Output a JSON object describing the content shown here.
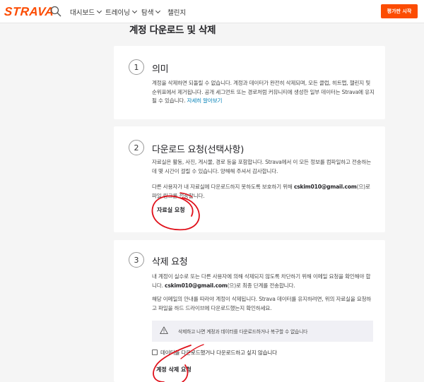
{
  "nav": {
    "logo": "STRAVA",
    "search_icon": "search-icon",
    "items": [
      {
        "label": "대시보드",
        "dropdown": true
      },
      {
        "label": "트레이닝",
        "dropdown": true
      },
      {
        "label": "탐색",
        "dropdown": true
      },
      {
        "label": "챌린지",
        "dropdown": false
      }
    ],
    "cta_label": "평가판 시작"
  },
  "page": {
    "title": "계정 다운로드 및 삭제"
  },
  "sections": {
    "meaning": {
      "number": "1",
      "title": "의미",
      "text": "계정을 삭제하면 되돌릴 수 없습니다. 계정과 데이터가 완전히 삭제되며, 모든 클럽, 히트맵, 챌린지 및 순위표에서 제거됩니다. 공개 세그먼트 또는 경로처럼 커뮤니티에 생성한 일부 데이터는 Strava에 유지될 수 있습니다.",
      "link": "자세히 알아보기"
    },
    "download": {
      "number": "2",
      "title": "다운로드 요청(선택사항)",
      "text1": "자료실은 활동, 사진, 게시물, 경로 등을 포함합니다. Strava에서 이 모든 정보를 컴파일하고 전송하는 데 몇 시간이 걸릴 수 있습니다. 양해해 주셔서 감사합니다.",
      "text2_pre": "다른 사용자가 내 자료실에 다운로드하지 못하도록 보호하기 위해 ",
      "email": "cskim010@gmail.com",
      "text2_post": "(으)로 파일 링크를 전송합니다.",
      "button": "자료실 요청"
    },
    "delete": {
      "number": "3",
      "title": "삭제 요청",
      "text1": "내 계정이 실수로 또는 다른 사용자에 의해 삭제되지 않도록 차단하기 위해 이메일 요청을 확인해야 합니다.",
      "email": "cskim010@gmail.com",
      "text1_post": "(으)로 최종 단계를 전송합니다.",
      "text2": "해당 이메일의 안내를 따라야 계정이 삭제됩니다. Strava 데이터를 유지하려면, 위의 자료실을 요청하고 파일을 하드 드라이브에 다운로드했는지 확인하세요.",
      "warning": "삭제하고 나면 계정과 데이터를 다운로드하거나 복구할 수 없습니다",
      "warning_icon": "warning-triangle-icon",
      "checkbox_label": "데이터를 다운로드했거나 다운로드하고 싶지 않습니다",
      "checkbox_checked": false,
      "button": "계정 삭제 요청"
    }
  },
  "colors": {
    "brand": "#fc4c02",
    "link": "#007fb6",
    "annotation": "#e0111b"
  }
}
